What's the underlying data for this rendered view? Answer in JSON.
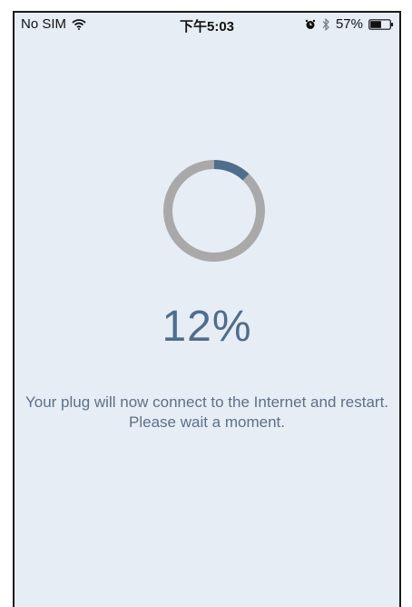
{
  "status_bar": {
    "carrier": "No SIM",
    "time": "下午5:03",
    "battery_percent": "57%",
    "battery_level": 0.57,
    "icons": [
      "wifi-icon",
      "alarm-icon",
      "bluetooth-icon",
      "battery-icon"
    ]
  },
  "progress": {
    "value": 0.12,
    "label": "12%",
    "track_color": "#a9a9a9",
    "fill_color": "#4f6d8c"
  },
  "message": "Your plug will now connect to the Internet and restart. Please wait a moment.",
  "colors": {
    "background": "#e7edf5",
    "text": "#5d7088",
    "accent": "#4f6d8c"
  }
}
